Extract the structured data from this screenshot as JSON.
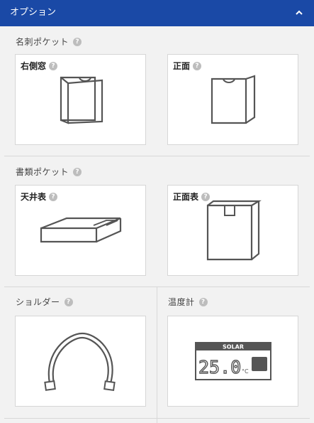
{
  "header": {
    "title": "オプション",
    "chevron_icon": "chevron-up-icon"
  },
  "sections": {
    "business_card_pocket": {
      "label": "名刺ポケット",
      "options": [
        {
          "label": "右側窓"
        },
        {
          "label": "正面"
        }
      ]
    },
    "document_pocket": {
      "label": "書類ポケット",
      "options": [
        {
          "label": "天井表"
        },
        {
          "label": "正面表"
        }
      ]
    },
    "shoulder": {
      "label": "ショルダー"
    },
    "thermometer": {
      "label": "温度計",
      "solar_text": "SOLAR",
      "reading": "25.0",
      "unit": "°C"
    }
  },
  "help_glyph": "?",
  "colors": {
    "header_bg": "#1a49a6",
    "header_text": "#ffffff",
    "icon_stroke": "#555555"
  }
}
